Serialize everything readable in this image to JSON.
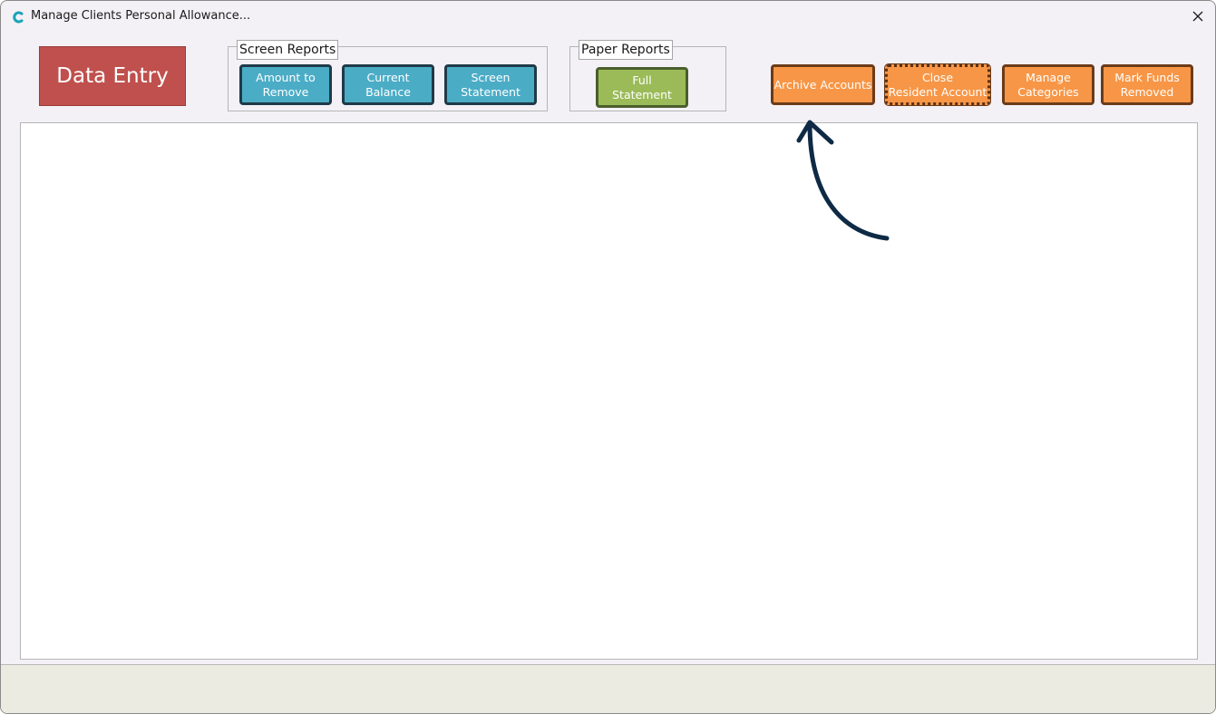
{
  "window": {
    "title": "Manage Clients Personal Allowance..."
  },
  "toolbar": {
    "data_entry_label": "Data Entry",
    "screen_reports": {
      "label": "Screen Reports",
      "buttons": [
        "Amount to\nRemove",
        "Current\nBalance",
        "Screen\nStatement"
      ]
    },
    "paper_reports": {
      "label": "Paper Reports",
      "buttons": [
        "Full\nStatement"
      ]
    },
    "actions": {
      "archive_accounts": "Archive Accounts",
      "close_resident_account": "Close\nResident Account",
      "manage_categories": "Manage\nCategories",
      "mark_funds_removed": "Mark Funds\nRemoved"
    }
  },
  "icons": {
    "app": "app-c-icon",
    "close": "close-icon",
    "annotation": "curved-arrow-annotation"
  },
  "colors": {
    "data_entry": "#c0504d",
    "screen_report_buttons": "#4bacc6",
    "paper_report_buttons": "#9bbb59",
    "action_buttons": "#f79646",
    "annotation_arrow": "#0e2a45"
  }
}
